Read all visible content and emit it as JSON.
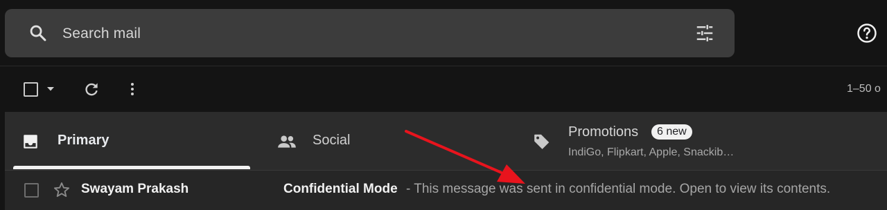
{
  "search": {
    "placeholder": "Search mail"
  },
  "icons": {
    "search": "search-icon",
    "filter": "tune-icon",
    "help": "help-icon",
    "checkbox": "checkbox-icon",
    "caret": "chevron-down-icon",
    "refresh": "refresh-icon",
    "more": "more-vert-icon",
    "inbox": "inbox-icon",
    "social": "people-icon",
    "promotions": "tag-icon",
    "star": "star-outline-icon"
  },
  "toolbar": {
    "pagination": "1–50 o"
  },
  "tabs": [
    {
      "label": "Primary",
      "active": true
    },
    {
      "label": "Social"
    },
    {
      "label": "Promotions",
      "badge": "6 new",
      "senders": "IndiGo, Flipkart, Apple, Snackib…"
    }
  ],
  "emails": [
    {
      "sender": "Swayam Prakash",
      "subject": "Confidential Mode",
      "snippet": " - This message was sent in confidential mode. Open to view its contents."
    }
  ],
  "colors": {
    "background": "#141414",
    "search_bar": "#3c3c3c",
    "tabs_bar": "#2c2c2c",
    "annotation_arrow": "#e8141d"
  }
}
